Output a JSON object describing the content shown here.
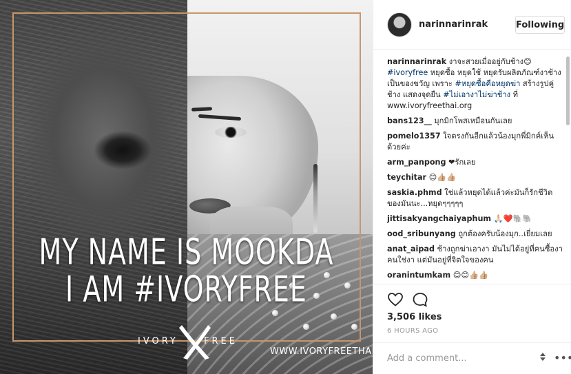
{
  "post_image": {
    "headline_line1": "MY NAME IS MOOKDA",
    "headline_line2": "I AM #IVORYFREE",
    "logo_left": "IVORY",
    "logo_right": "FREE",
    "site_url": "WWW.IVORYFREETHAI.ORG",
    "frame_color": "#c8966a"
  },
  "header": {
    "username": "narinnarinrak",
    "follow_label": "Following"
  },
  "caption": {
    "user": "narinnarinrak",
    "parts": [
      {
        "text": " งาจะสวยเมื่ออยู่กับช้าง😊 ",
        "tag": false
      },
      {
        "text": "#ivoryfree",
        "tag": true
      },
      {
        "text": " หยุดซื้อ หยุดใช้ หยุดรับผลิตภัณฑ์งาช้างเป็นของขวัญ เพราะ ",
        "tag": false
      },
      {
        "text": "#หยุดซื้อคือหยุดฆ่า",
        "tag": true
      },
      {
        "text": " สร้างรูปคู่ช้าง แสดงจุดยืน ",
        "tag": false
      },
      {
        "text": "#ไม่เอางาไม่ฆ่าช้าง",
        "tag": true
      },
      {
        "text": " ที่ www.ivoryfreethai.org",
        "tag": false
      }
    ]
  },
  "comments": [
    {
      "user": "bans123__",
      "text": "มุกมิกโพสเหมือนกันเลย"
    },
    {
      "user": "pomelo1357",
      "text": "ใจตรงกันอีกแล้วน้องมุกพี่มิกค์เห็นด้วยค่ะ"
    },
    {
      "user": "arm_panpong",
      "text": "❤รักเลย"
    },
    {
      "user": "teychitar",
      "text": "😊👍🏼👍🏼"
    },
    {
      "user": "saskia.phmd",
      "text": "ใช่แล้วหยุดได้แล้วค่ะมันก็รักชีวิตของมันนะ...หยุดๆๆๆๆๆ"
    },
    {
      "user": "jittisakyangchaiyaphum",
      "text": "🙏🏻❤️🐘🐘"
    },
    {
      "user": "ood_sribunyang",
      "text": "ถูกต้องครับน้องมุก..เยี่ยมเลย"
    },
    {
      "user": "anat_aipad",
      "text": "ช้างถูกฆ่าเอางา มันไม่ได้อยู่ที่คนซื้องา คนใช่งา แต่มันอยู่ที่จิตใจของคน"
    },
    {
      "user": "oranintumkam",
      "text": "😊😊👍🏼👍🏼"
    }
  ],
  "actions": {
    "like_icon": "heart-icon",
    "comment_icon": "comment-bubble-icon",
    "likes_text": "3,506 likes",
    "time_text": "6 HOURS AGO"
  },
  "add_comment": {
    "placeholder": "Add a comment...",
    "more_symbol": "•••"
  }
}
